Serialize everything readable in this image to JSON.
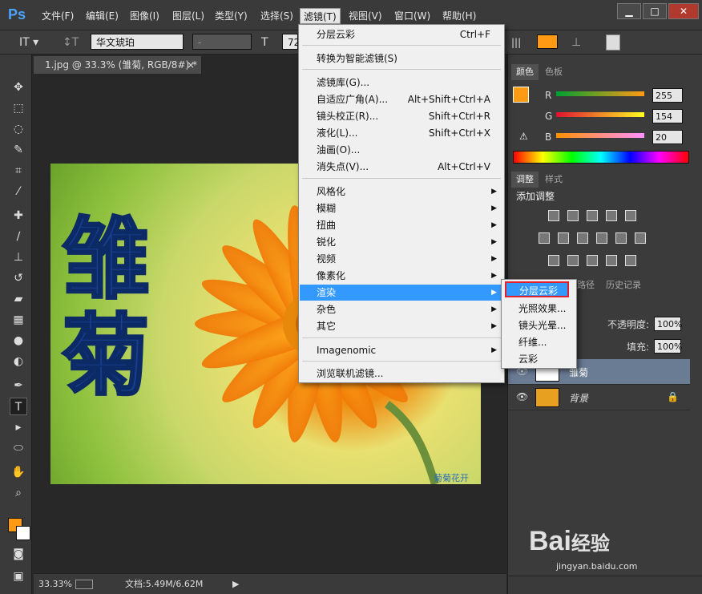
{
  "app": {
    "logo": "Ps"
  },
  "menubar": {
    "items": [
      "文件(F)",
      "编辑(E)",
      "图像(I)",
      "图层(L)",
      "类型(Y)",
      "选择(S)",
      "滤镜(T)",
      "视图(V)",
      "窗口(W)",
      "帮助(H)"
    ],
    "window_controls": [
      "▁",
      "□",
      "✕"
    ]
  },
  "options": {
    "font_family": "华文琥珀",
    "font_style": "-",
    "font_size": "72"
  },
  "document": {
    "tab_title": "1.jpg @ 33.3% (雏菊, RGB/8#) *",
    "tab_close": "×",
    "text_layer": [
      "雏",
      "菊"
    ],
    "watermark": "菊菊花开"
  },
  "status": {
    "zoom": "33.33%",
    "doc": "文档:5.49M/6.62M"
  },
  "filter_menu": {
    "top": [
      {
        "label": "分层云彩",
        "shortcut": "Ctrl+F"
      }
    ],
    "smart": [
      {
        "label": "转换为智能滤镜(S)",
        "shortcut": ""
      }
    ],
    "gallery": [
      {
        "label": "滤镜库(G)...",
        "shortcut": ""
      },
      {
        "label": "自适应广角(A)...",
        "shortcut": "Alt+Shift+Ctrl+A"
      },
      {
        "label": "镜头校正(R)...",
        "shortcut": "Shift+Ctrl+R"
      },
      {
        "label": "液化(L)...",
        "shortcut": "Shift+Ctrl+X"
      },
      {
        "label": "油画(O)...",
        "shortcut": ""
      },
      {
        "label": "消失点(V)...",
        "shortcut": "Alt+Ctrl+V"
      }
    ],
    "categories": [
      "风格化",
      "模糊",
      "扭曲",
      "锐化",
      "视频",
      "像素化",
      "渲染",
      "杂色",
      "其它"
    ],
    "plugins": [
      "Imagenomic"
    ],
    "browse": [
      "浏览联机滤镜..."
    ]
  },
  "render_submenu": [
    "分层云彩",
    "光照效果...",
    "镜头光晕...",
    "纤维...",
    "云彩"
  ],
  "color_panel": {
    "tabs": [
      "颜色",
      "色板"
    ],
    "channels": [
      {
        "name": "R",
        "value": "255"
      },
      {
        "name": "G",
        "value": "154"
      },
      {
        "name": "B",
        "value": "20"
      }
    ],
    "foreground": "#ff9a14",
    "background": "#ffffff"
  },
  "adjust_panel": {
    "tabs": [
      "调整",
      "样式"
    ],
    "title": "添加调整"
  },
  "layers_panel": {
    "tabs": [
      "路径",
      "历史记录"
    ],
    "opacity_label": "不透明度:",
    "opacity_value": "100%",
    "fill_label": "填充:",
    "fill_value": "100%",
    "layers": [
      {
        "name": "雏菊"
      },
      {
        "name": "背景"
      }
    ]
  },
  "brand_watermark": {
    "text": "Bai",
    "suffix": "经验",
    "url": "jingyan.baidu.com"
  },
  "colors": {
    "accent": "#3399ff",
    "highlight_box": "#e0202a",
    "text_fill": "#1a3f8f"
  }
}
